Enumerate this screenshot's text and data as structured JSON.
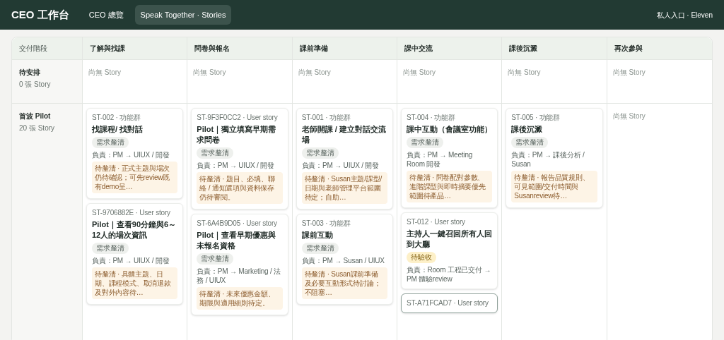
{
  "app": {
    "title": "CEO 工作台",
    "user": "私人入口 · Eleven"
  },
  "nav_tabs": [
    {
      "label": "CEO 總覽",
      "selected": false
    },
    {
      "label": "Speak Together · Stories",
      "selected": true
    }
  ],
  "board": {
    "corner_header": "交付階段",
    "stages": [
      "了解與找課",
      "問卷與報名",
      "課前準備",
      "課中交流",
      "課後沉澱",
      "再次參與"
    ],
    "rows": [
      {
        "title": "待安排",
        "count": "0 張 Story",
        "cells": [
          {
            "empty_text": "尚無 Story"
          },
          {
            "empty_text": "尚無 Story"
          },
          {
            "empty_text": "尚無 Story"
          },
          {
            "empty_text": "尚無 Story"
          },
          {
            "empty_text": "尚無 Story"
          },
          {
            "empty_text": "尚無 Story"
          }
        ]
      },
      {
        "title": "首波 Pilot",
        "count": "20 張 Story",
        "cells": [
          {
            "cards": [
              {
                "meta": "ST-002 · 功能群",
                "title": "找課程/ 找對話",
                "status": {
                  "label": "需求釐清",
                  "kind": "clarify"
                },
                "owner": "負責：PM → UIUX / 開發",
                "note": "待釐清 · 正式主題與場次仍待確認；可先review既有demo呈…",
                "selected": false
              },
              {
                "meta": "ST-9706882E · User story",
                "title": "Pilot｜查看90分鐘與6～12人的場次資訊",
                "status": {
                  "label": "需求釐清",
                  "kind": "clarify"
                },
                "owner": "負責：PM → UIUX / 開發",
                "note": "待釐清 · 具體主題、日期、課程模式、取消退款及對外內容待…",
                "selected": false
              }
            ]
          },
          {
            "cards": [
              {
                "meta": "ST-9F3F0CC2 · User story",
                "title": "Pilot｜獨立填寫早期需求問卷",
                "status": {
                  "label": "需求釐清",
                  "kind": "clarify"
                },
                "owner": "負責：PM → UIUX / 開發",
                "note": "待釐清 · 題目、必填、聯絡 / 通知選項與資料保存仍待審閱。",
                "selected": false
              },
              {
                "meta": "ST-6A4B9D05 · User story",
                "title": "Pilot｜查看早期優惠與未報名資格",
                "status": {
                  "label": "需求釐清",
                  "kind": "clarify"
                },
                "owner": "負責：PM → Marketing / 法務 / UIUX",
                "note": "待釐清 · 未來優惠金額、期限與適用細則待定。",
                "selected": false
              }
            ]
          },
          {
            "cards": [
              {
                "meta": "ST-001 · 功能群",
                "title": "老師開課 / 建立對話交流場",
                "status": {
                  "label": "需求釐清",
                  "kind": "clarify"
                },
                "owner": "負責：PM → UIUX / 開發",
                "note": "待釐清 · Susan主題/課型/日期與老師管理平台範圍待定；自助…",
                "selected": false
              },
              {
                "meta": "ST-003 · 功能群",
                "title": "課前互動",
                "status": {
                  "label": "需求釐清",
                  "kind": "clarify"
                },
                "owner": "負責：PM → Susan / UIUX",
                "note": "待釐清 · Susan課前準備及必要互動形式待討論；不阻塞…",
                "selected": false
              }
            ]
          },
          {
            "cards": [
              {
                "meta": "ST-004 · 功能群",
                "title": "課中互動（會議室功能）",
                "status": {
                  "label": "需求釐清",
                  "kind": "clarify"
                },
                "owner": "負責：PM → Meeting Room 開發",
                "note": "待釐清 · 問卷配對參數、進階課型與即時摘要優先範圍待產品…",
                "selected": false
              },
              {
                "meta": "ST-012 · User story",
                "title": "主持人一鍵召回所有人回到大廳",
                "status": {
                  "label": "待驗收",
                  "kind": "acceptance"
                },
                "owner": "負責：Room 工程已交付 → PM 體驗review",
                "selected": false
              },
              {
                "meta": "ST-A71FCAD7 · User story",
                "selected": true
              }
            ]
          },
          {
            "cards": [
              {
                "meta": "ST-005 · 功能群",
                "title": "課後沉澱",
                "status": {
                  "label": "需求釐清",
                  "kind": "clarify"
                },
                "owner": "負責：PM → 課後分析 / Susan",
                "note": "待釐清 · 報告品質規則、可見範圍/交付時間與Susanreview待…",
                "selected": false
              }
            ]
          },
          {
            "empty_text": "尚無 Story"
          }
        ]
      }
    ]
  }
}
